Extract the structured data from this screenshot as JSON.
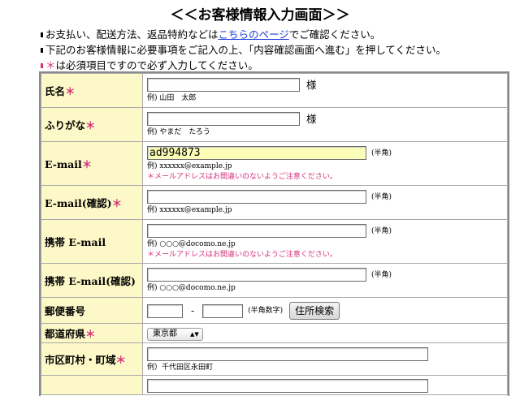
{
  "title": "＜＜お客様情報入力画面＞＞",
  "notes": {
    "line1_pre": "お支払い、配送方法、返品特約などは",
    "line1_link": "こちらのページ",
    "line1_post": "でご確認ください。",
    "line2": "下記のお客様情報に必要事項をご記入の上、「内容確認画面へ進む」を押してください。",
    "line3_star": "＊",
    "line3": "は必須項目ですので必ず入力してください。"
  },
  "required_mark": "＊",
  "fields": {
    "name": {
      "label": "氏名",
      "value": "",
      "suffix": "様",
      "example": "例) 山田　太郎"
    },
    "furigana": {
      "label": "ふりがな",
      "value": "",
      "suffix": "様",
      "example": "例) やまだ　たろう"
    },
    "email": {
      "label": "E-mail",
      "value": "ad994873",
      "note": "(半角)",
      "example": "例) xxxxxx@example.jp",
      "warning": "＊メールアドレスはお間違いのないようご注意ください。"
    },
    "email_confirm": {
      "label": "E-mail(確認)",
      "value": "",
      "note": "(半角)",
      "example": "例) xxxxxx@example.jp"
    },
    "mobile_email": {
      "label": "携帯 E-mail",
      "value": "",
      "note": "(半角)",
      "example": "例) ○○○@docomo.ne.jp",
      "warning": "＊メールアドレスはお間違いのないようご注意ください。"
    },
    "mobile_email_confirm": {
      "label": "携帯 E-mail(確認)",
      "value": "",
      "note": "(半角)",
      "example": "例) ○○○@docomo.ne.jp"
    },
    "postal": {
      "label": "郵便番号",
      "value1": "",
      "value2": "",
      "dash": "-",
      "note": "(半角数字)",
      "button": "住所検索"
    },
    "prefecture": {
      "label": "都道府県",
      "selected": "東京都",
      "arrows": "▲▼"
    },
    "city": {
      "label": "市区町村・町域",
      "value": "",
      "example": "例）千代田区永田町"
    }
  }
}
